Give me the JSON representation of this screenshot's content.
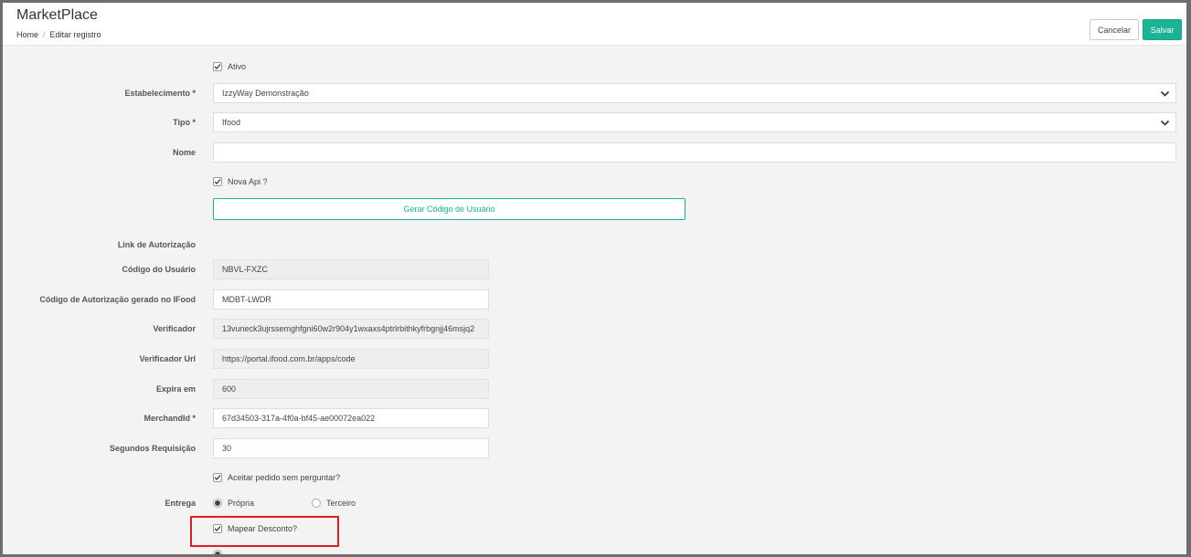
{
  "header": {
    "title": "MarketPlace",
    "breadcrumb": {
      "home": "Home",
      "separator": "/",
      "current": "Editar registro"
    },
    "cancel_label": "Cancelar",
    "save_label": "Salvar"
  },
  "form": {
    "ativo": {
      "label": "Ativo",
      "checked": true
    },
    "estabelecimento": {
      "label": "Estabelecimento *",
      "value": "IzzyWay Demonstração"
    },
    "tipo": {
      "label": "Tipo *",
      "value": "Ifood"
    },
    "nome": {
      "label": "Nome",
      "value": ""
    },
    "nova_api": {
      "label": "Nova Api ?",
      "checked": true
    },
    "gerar_button": "Gerar Código de Usuário",
    "link_autorizacao": {
      "label": "Link de Autorização"
    },
    "codigo_usuario": {
      "label": "Código do Usuário",
      "value": "NBVL-FXZC"
    },
    "codigo_autorizacao": {
      "label": "Código de Autorização gerado no IFood",
      "value": "MDBT-LWDR"
    },
    "verificador": {
      "label": "Verificador",
      "value": "13vuneck3ujrssemghfgni60w2r904y1wxaxs4ptrlrbithkyfrbgnjj46msjq2"
    },
    "verificador_url": {
      "label": "Verificador Url",
      "value": "https://portal.ifood.com.br/apps/code"
    },
    "expira_em": {
      "label": "Expira em",
      "value": "600"
    },
    "merchand_id": {
      "label": "MerchandId *",
      "value": "67d34503-317a-4f0a-bf45-ae00072ea022"
    },
    "segundos_requisicao": {
      "label": "Segundos Requisição",
      "value": "30"
    },
    "aceitar_pedido": {
      "label": "Aceitar pedido sem perguntar?",
      "checked": true
    },
    "entrega": {
      "label": "Entrega",
      "options": [
        {
          "label": "Própria",
          "selected": true
        },
        {
          "label": "Terceiro",
          "selected": false
        }
      ]
    },
    "mapear_desconto": {
      "label": "Mapear Desconto?",
      "checked": true
    }
  },
  "colors": {
    "accent": "#1ab394",
    "highlight": "#e02020"
  }
}
